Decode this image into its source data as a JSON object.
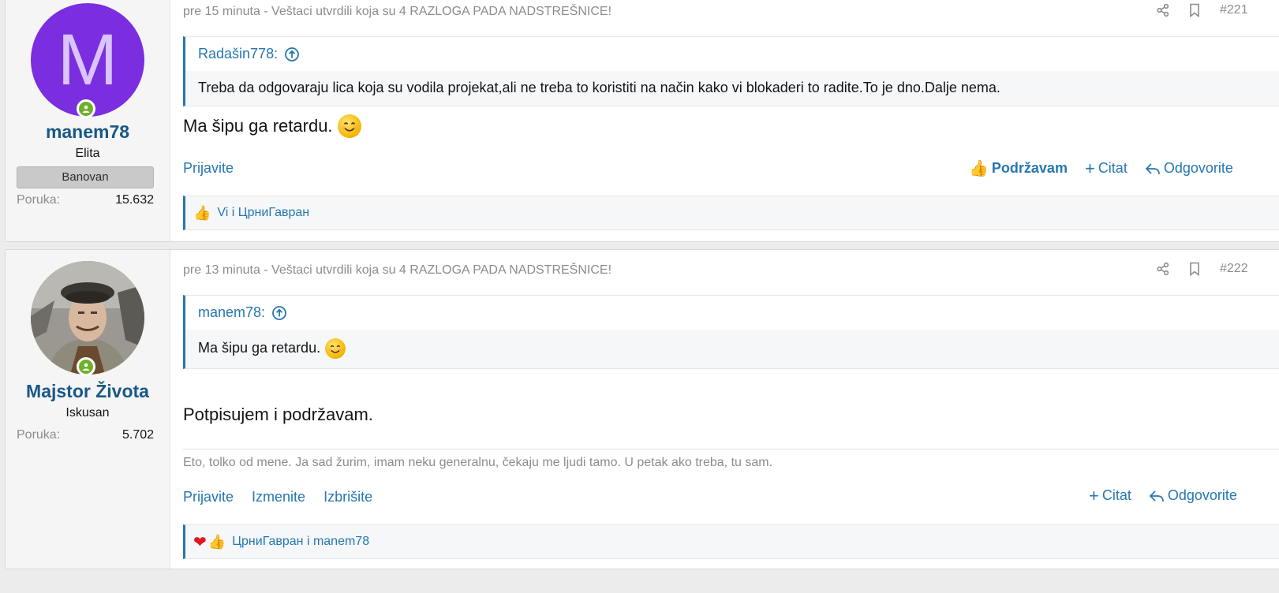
{
  "posts": [
    {
      "user": {
        "avatar_letter": "M",
        "username": "manem78",
        "title": "Elita",
        "banner": "Banovan",
        "stat_label": "Poruka:",
        "stat_value": "15.632"
      },
      "meta": "pre 15 minuta - Veštaci utvrdili koja su 4 RAZLOGA PADA NADSTREŠNICE!",
      "post_number": "#221",
      "quote": {
        "author": "Radašin778:",
        "text": "Treba da odgovaraju lica koja su vodila projekat,ali ne treba to koristiti na način kako vi blokaderi to radite.To je dno.Dalje nema."
      },
      "message": "Ma šipu ga retardu.",
      "actions_left": [
        "Prijavite"
      ],
      "actions_right": {
        "like": "Podržavam",
        "quote": "Citat",
        "reply": "Odgovorite"
      },
      "reactions": "Vi i ЦрниГавран"
    },
    {
      "user": {
        "username": "Majstor Života",
        "title": "Iskusan",
        "stat_label": "Poruka:",
        "stat_value": "5.702"
      },
      "meta": "pre 13 minuta - Veštaci utvrdili koja su 4 RAZLOGA PADA NADSTREŠNICE!",
      "post_number": "#222",
      "quote": {
        "author": "manem78:",
        "text": "Ma šipu ga retardu."
      },
      "message": "Potpisujem i podržavam.",
      "signature": "Eto, tolko od mene. Ja sad žurim, imam neku generalnu, čekaju me ljudi tamo. U petak ako treba, tu sam.",
      "actions_left": [
        "Prijavite",
        "Izmenite",
        "Izbrišite"
      ],
      "actions_right": {
        "quote": "Citat",
        "reply": "Odgovorite"
      },
      "reactions": "ЦрниГавран i manem78"
    }
  ]
}
